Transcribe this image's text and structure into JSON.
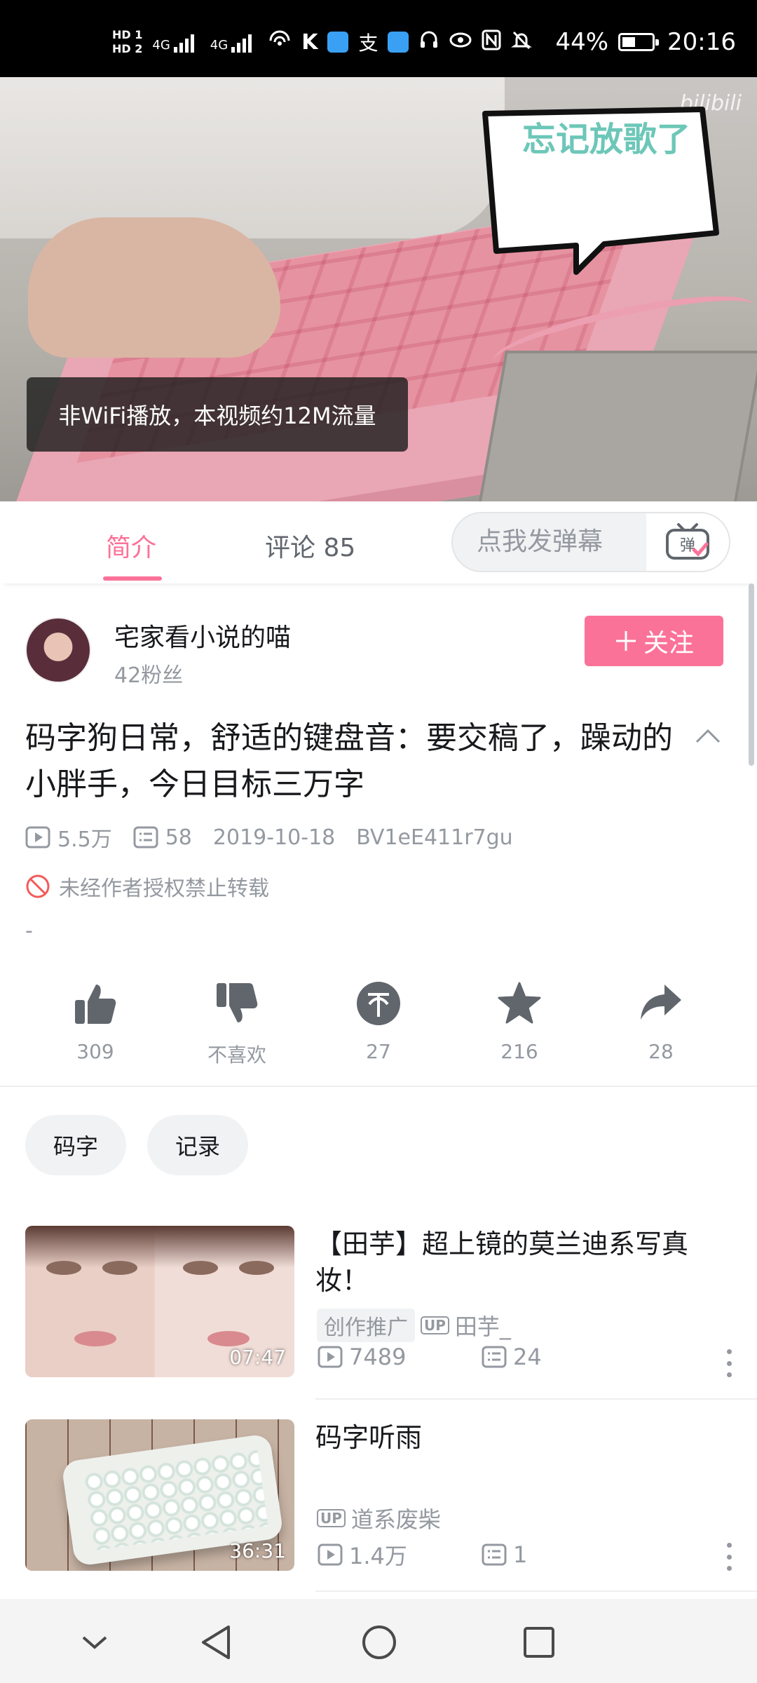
{
  "status_bar": {
    "hd1": "HD 1",
    "hd2": "HD 2",
    "signal1": "4G",
    "signal2": "4G",
    "hotspot_count": "1",
    "icons": [
      "signal-icon",
      "wifi-hotspot-icon",
      "k-app-icon",
      "app-icon",
      "alipay-icon",
      "app-icon",
      "headset-icon",
      "eye-icon",
      "nfc-icon",
      "mute-icon",
      "battery-icon"
    ],
    "battery": "44%",
    "time": "20:16"
  },
  "video": {
    "watermark": "bilibili",
    "bubble_text": "忘记放歌了",
    "toast": "非WiFi播放，本视频约12M流量"
  },
  "tabs": {
    "intro": "简介",
    "comments": "评论 85",
    "danmaku_placeholder": "点我发弹幕",
    "danmaku_icon_label": "弹"
  },
  "uploader": {
    "name": "宅家看小说的喵",
    "fans": "42粉丝",
    "follow_label": "关注"
  },
  "video_info": {
    "title": "码字狗日常，舒适的键盘音：要交稿了，躁动的小胖手，今日目标三万字",
    "views": "5.5万",
    "danmaku_count": "58",
    "date": "2019-10-18",
    "bvid": "BV1eE411r7gu",
    "no_reprint": "未经作者授权禁止转载",
    "description": "-"
  },
  "actions": {
    "like": "309",
    "dislike": "不喜欢",
    "coin": "27",
    "favorite": "216",
    "share": "28"
  },
  "tags": [
    "码字",
    "记录"
  ],
  "related": [
    {
      "title": "【田芋】超上镜的莫兰迪系写真妆！",
      "promo": "创作推广",
      "up_badge": "UP",
      "uploader": "田芋_",
      "views": "7489",
      "danmaku": "24",
      "duration": "07:47"
    },
    {
      "title": "码字听雨",
      "up_badge": "UP",
      "uploader": "道系废柴",
      "views": "1.4万",
      "danmaku": "1",
      "duration": "36:31"
    }
  ],
  "colors": {
    "accent": "#fb7299",
    "text": "#18191c",
    "secondary": "#9499a0"
  }
}
